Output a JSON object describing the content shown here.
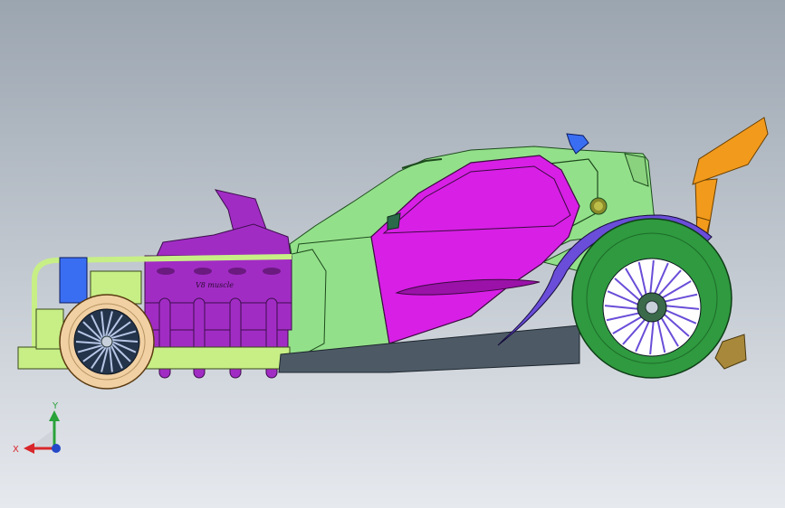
{
  "viewport": {
    "background_top": "#9ba5b0",
    "background_bottom": "#e6e9ee"
  },
  "model": {
    "engine_block_text": "V8 muscle",
    "colors": {
      "body": "#93e08a",
      "door": "#d81fe6",
      "engine": "#a12cc4",
      "wing": "#f29a1c",
      "rear_tire": "#2f9a3f",
      "front_tire": "#f1d0a3",
      "rims": "#6a4dd8",
      "skirt": "#4d5a66",
      "frame": "#c7ef86",
      "scoop": "#3a6ef2"
    }
  },
  "triad": {
    "x_label": "X",
    "y_label": "Y",
    "x_color": "#d8262a",
    "y_color": "#2aa23a",
    "z_color": "#2448c8"
  }
}
